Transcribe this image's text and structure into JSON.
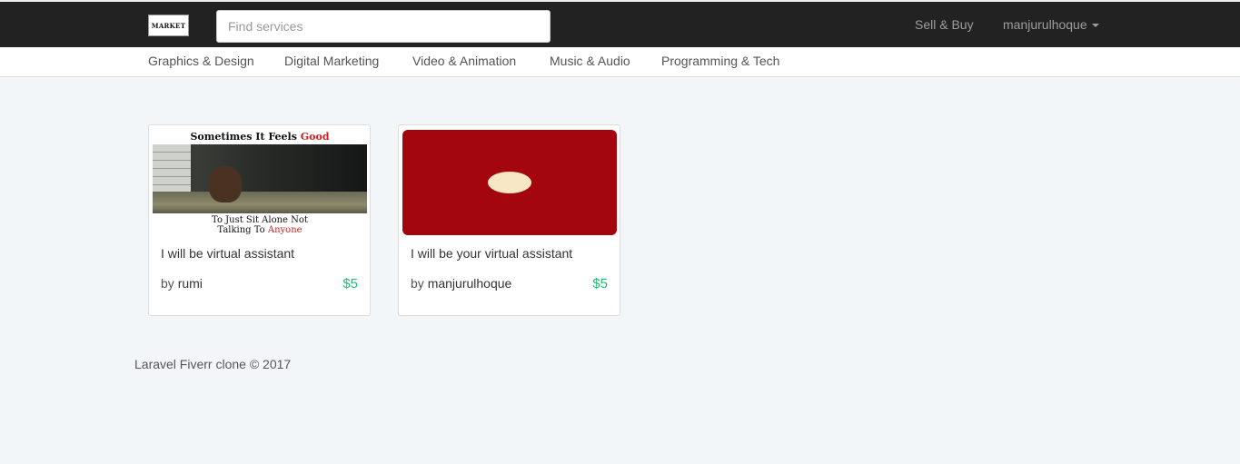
{
  "header": {
    "logo_text": "MARKET",
    "search_placeholder": "Find services",
    "sell_buy": "Sell & Buy",
    "username": "manjurulhoque"
  },
  "categories": [
    "Graphics & Design",
    "Digital Marketing",
    "Video & Animation",
    "Music & Audio",
    "Programming & Tech"
  ],
  "services": [
    {
      "title": "I will be virtual assistant",
      "by": "by",
      "author": "rumi",
      "price": "$5",
      "image_text": {
        "top_pre": "Sometimes It Feels ",
        "top_em": "Good",
        "line1": "To Just Sit Alone Not",
        "line2_pre": "Talking To ",
        "line2_em": "Anyone"
      }
    },
    {
      "title": "I will be your virtual assistant",
      "by": "by",
      "author": "manjurulhoque",
      "price": "$5"
    }
  ],
  "footer": {
    "text": "Laravel Fiverr clone © 2017"
  },
  "colors": {
    "topbar": "#222222",
    "price": "#1dbf73",
    "thumb2": "#a3060c"
  }
}
